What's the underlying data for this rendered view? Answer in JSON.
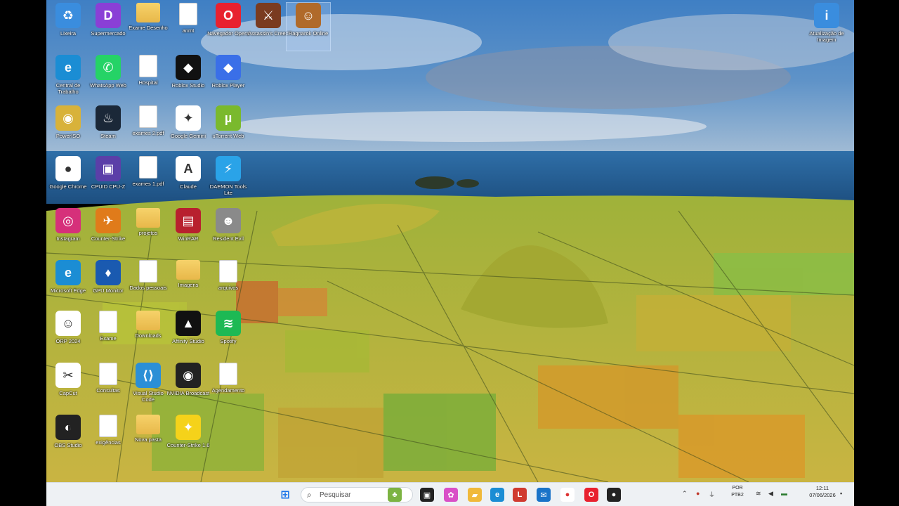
{
  "desktop": {
    "icons": [
      {
        "id": "recycle",
        "label": "Lixeira",
        "color": "#3a8dde",
        "glyph": "♻",
        "kind": "tile"
      },
      {
        "id": "deezer",
        "label": "Supermercado",
        "color": "#8a3fd6",
        "glyph": "D",
        "kind": "tile"
      },
      {
        "id": "folder1",
        "label": "Exame Desenho",
        "kind": "folder"
      },
      {
        "id": "doc1",
        "label": "anmt",
        "kind": "doc"
      },
      {
        "id": "opera",
        "label": "Navegador Opera",
        "color": "#e8212f",
        "glyph": "O",
        "kind": "tile"
      },
      {
        "id": "game1",
        "label": "Assassin's Creed",
        "color": "#7a3b20",
        "glyph": "⚔",
        "kind": "tile"
      },
      {
        "id": "game2",
        "label": "Ragnarok Online",
        "color": "#b06a2a",
        "glyph": "☺",
        "kind": "tile"
      },
      {
        "id": "edge1",
        "label": "Central de Trabalho",
        "color": "#1b8dd4",
        "glyph": "e",
        "kind": "tile"
      },
      {
        "id": "whatsapp",
        "label": "WhatsApp Web",
        "color": "#25d366",
        "glyph": "✆",
        "kind": "tile"
      },
      {
        "id": "doc2",
        "label": "Hospital",
        "kind": "doc"
      },
      {
        "id": "roblox1",
        "label": "Roblox Studio",
        "color": "#111111",
        "glyph": "◆",
        "kind": "tile"
      },
      {
        "id": "roblox2",
        "label": "Roblox Player",
        "color": "#3a6fe8",
        "glyph": "◆",
        "kind": "tile"
      },
      {
        "id": "disc",
        "label": "PowerISO",
        "color": "#d8b23a",
        "glyph": "◉",
        "kind": "tile"
      },
      {
        "id": "steam",
        "label": "Steam",
        "color": "#1b2838",
        "glyph": "♨",
        "kind": "tile"
      },
      {
        "id": "doc3",
        "label": "exames 2.pdf",
        "kind": "doc"
      },
      {
        "id": "gemini",
        "label": "Google Gemini",
        "color": "#ffffff",
        "glyph": "✦",
        "kind": "tile"
      },
      {
        "id": "utorrent",
        "label": "uTorrent Web",
        "color": "#7ab92d",
        "glyph": "µ",
        "kind": "tile"
      },
      {
        "id": "chrome",
        "label": "Google Chrome",
        "color": "#ffffff",
        "glyph": "●",
        "kind": "tile"
      },
      {
        "id": "cpuz",
        "label": "CPUID CPU-Z",
        "color": "#5b3fa8",
        "glyph": "▣",
        "kind": "tile"
      },
      {
        "id": "doc4",
        "label": "exames 1.pdf",
        "kind": "doc"
      },
      {
        "id": "claude",
        "label": "Claude",
        "color": "#ffffff",
        "glyph": "A",
        "kind": "tile"
      },
      {
        "id": "daemon",
        "label": "DAEMON Tools Lite",
        "color": "#2aa3e8",
        "glyph": "⚡",
        "kind": "tile"
      },
      {
        "id": "instagram",
        "label": "Instagram",
        "color": "#d6307a",
        "glyph": "◎",
        "kind": "tile"
      },
      {
        "id": "cs1",
        "label": "Counter-Strike",
        "color": "#e07b1a",
        "glyph": "✈",
        "kind": "tile"
      },
      {
        "id": "folder2",
        "label": "projetos",
        "kind": "folder"
      },
      {
        "id": "winrar",
        "label": "WinRAR",
        "color": "#b8202e",
        "glyph": "▤",
        "kind": "tile"
      },
      {
        "id": "game3",
        "label": "Resident Evil",
        "color": "#8a8a8a",
        "glyph": "☻",
        "kind": "tile"
      },
      {
        "id": "edge2",
        "label": "Microsoft Edge",
        "color": "#1b8dd4",
        "glyph": "e",
        "kind": "tile"
      },
      {
        "id": "gpu",
        "label": "GPU Monitor",
        "color": "#1a5ab0",
        "glyph": "♦",
        "kind": "tile"
      },
      {
        "id": "doc5",
        "label": "Dados pessoais",
        "kind": "doc"
      },
      {
        "id": "folder3",
        "label": "Imagens",
        "kind": "folder"
      },
      {
        "id": "doc6",
        "label": "arquivos",
        "kind": "doc"
      },
      {
        "id": "photo1",
        "label": "ORP 2024",
        "color": "#ffffff",
        "glyph": "☺",
        "kind": "tile"
      },
      {
        "id": "doc7",
        "label": "Exame",
        "kind": "doc"
      },
      {
        "id": "folder4",
        "label": "Downloads",
        "kind": "folder"
      },
      {
        "id": "triangle",
        "label": "Affinity Studio",
        "color": "#111111",
        "glyph": "▲",
        "kind": "tile"
      },
      {
        "id": "spotify",
        "label": "Spotify",
        "color": "#1db954",
        "glyph": "≋",
        "kind": "tile"
      },
      {
        "id": "capcut",
        "label": "CapCut",
        "color": "#ffffff",
        "glyph": "✂",
        "kind": "tile"
      },
      {
        "id": "doc8",
        "label": "Consultas",
        "kind": "doc"
      },
      {
        "id": "vscode",
        "label": "Visual Studio Code",
        "color": "#2b8fd6",
        "glyph": "⟨⟩",
        "kind": "tile"
      },
      {
        "id": "obscam",
        "label": "NVIDIA Broadcast",
        "color": "#222222",
        "glyph": "◉",
        "kind": "tile"
      },
      {
        "id": "doc9",
        "label": "Agendamento",
        "kind": "doc"
      },
      {
        "id": "obs",
        "label": "OBS Studio",
        "color": "#222222",
        "glyph": "◐",
        "kind": "tile"
      },
      {
        "id": "doc10",
        "label": "exigências",
        "kind": "doc"
      },
      {
        "id": "folder5",
        "label": "Nova pasta",
        "kind": "folder"
      },
      {
        "id": "cs2",
        "label": "Counter-Strike 1.6",
        "color": "#f5d21a",
        "glyph": "✦",
        "kind": "tile"
      },
      {
        "id": "topright",
        "label": "Atualização de Imagem",
        "color": "#3a8dde",
        "glyph": "i",
        "kind": "tile"
      }
    ]
  },
  "taskbar": {
    "search_placeholder": "Pesquisar",
    "search_icon": "search-icon",
    "start_icon": "windows-start-icon",
    "pinned": [
      {
        "id": "tb-game",
        "color": "#7cb342",
        "glyph": "♣"
      },
      {
        "id": "tb-taskview",
        "color": "#222222",
        "glyph": "▣"
      },
      {
        "id": "tb-copilot",
        "color": "#d94fc7",
        "glyph": "✿"
      },
      {
        "id": "tb-explorer",
        "color": "#f0b93a",
        "glyph": "▰"
      },
      {
        "id": "tb-edge",
        "color": "#1b8dd4",
        "glyph": "e"
      },
      {
        "id": "tb-office",
        "color": "#d03a2f",
        "glyph": "L"
      },
      {
        "id": "tb-mail",
        "color": "#1a73c8",
        "glyph": "✉"
      },
      {
        "id": "tb-chrome",
        "color": "#ffffff",
        "glyph": "●"
      },
      {
        "id": "tb-opera",
        "color": "#e8212f",
        "glyph": "O"
      },
      {
        "id": "tb-record",
        "color": "#222222",
        "glyph": "●"
      }
    ],
    "lang_line1": "POR",
    "lang_line2": "PTB2",
    "time": "12:11",
    "date": "07/06/2026"
  }
}
